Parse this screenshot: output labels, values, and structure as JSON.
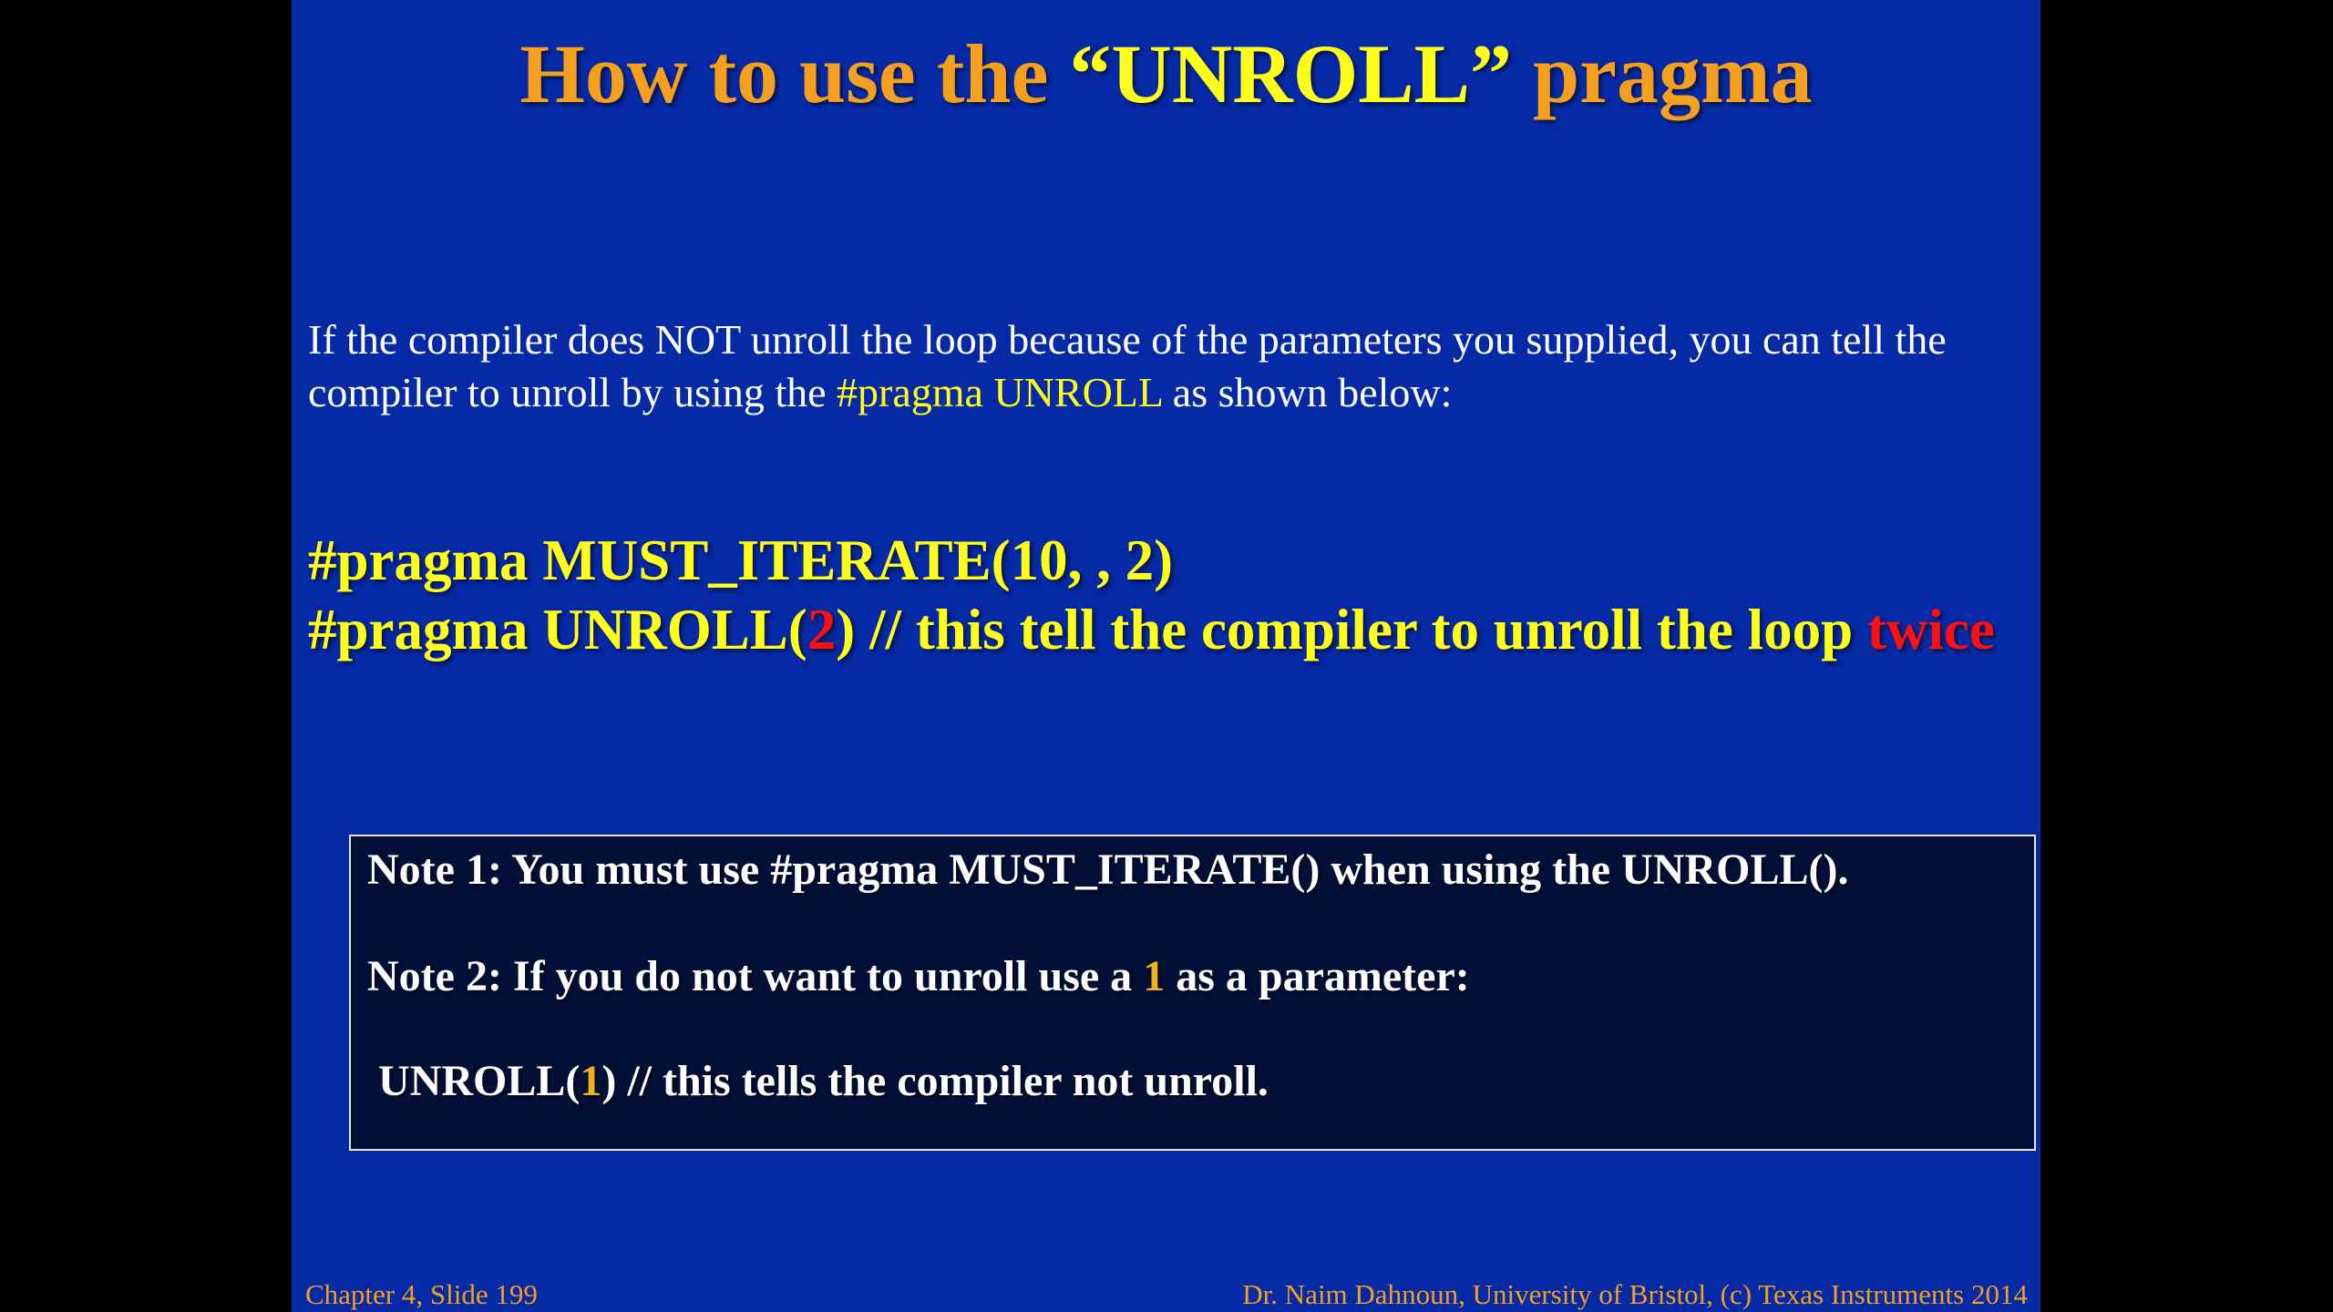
{
  "slide": {
    "title": {
      "part1": "How to use the ",
      "part2": "“UNROLL”",
      "part3": " pragma"
    },
    "intro": {
      "line1": "If the compiler does NOT unroll the loop because of the parameters you supplied, you can tell the",
      "line2_prefix": "compiler to unroll by using the ",
      "line2_highlight": "#pragma UNROLL",
      "line2_suffix": " as shown below:"
    },
    "code": {
      "line1": "#pragma MUST_ITERATE(10, , 2)",
      "line2_prefix": "#pragma UNROLL(",
      "line2_param": "2",
      "line2_mid": ") // this tell the compiler to unroll the loop ",
      "line2_emphasis": "twice"
    },
    "notes": {
      "note1": "Note 1: You must use  #pragma MUST_ITERATE() when using the UNROLL().",
      "note2_prefix": "Note 2: If you do not want to unroll  use a ",
      "note2_param": "1",
      "note2_suffix": " as a parameter:",
      "note3_prefix": "UNROLL(",
      "note3_param": "1",
      "note3_suffix": ")  // this tells the compiler not unroll."
    },
    "footer": {
      "left": "Chapter 4, Slide 199",
      "right": "Dr. Naim Dahnoun, University of Bristol,  (c) Texas Instruments 2014"
    },
    "colors": {
      "background": "#062aa6",
      "title_orange": "#f4a01e",
      "title_yellow": "#ffff1a",
      "emphasis_red": "#ff1010",
      "note_box": "#021038"
    }
  }
}
